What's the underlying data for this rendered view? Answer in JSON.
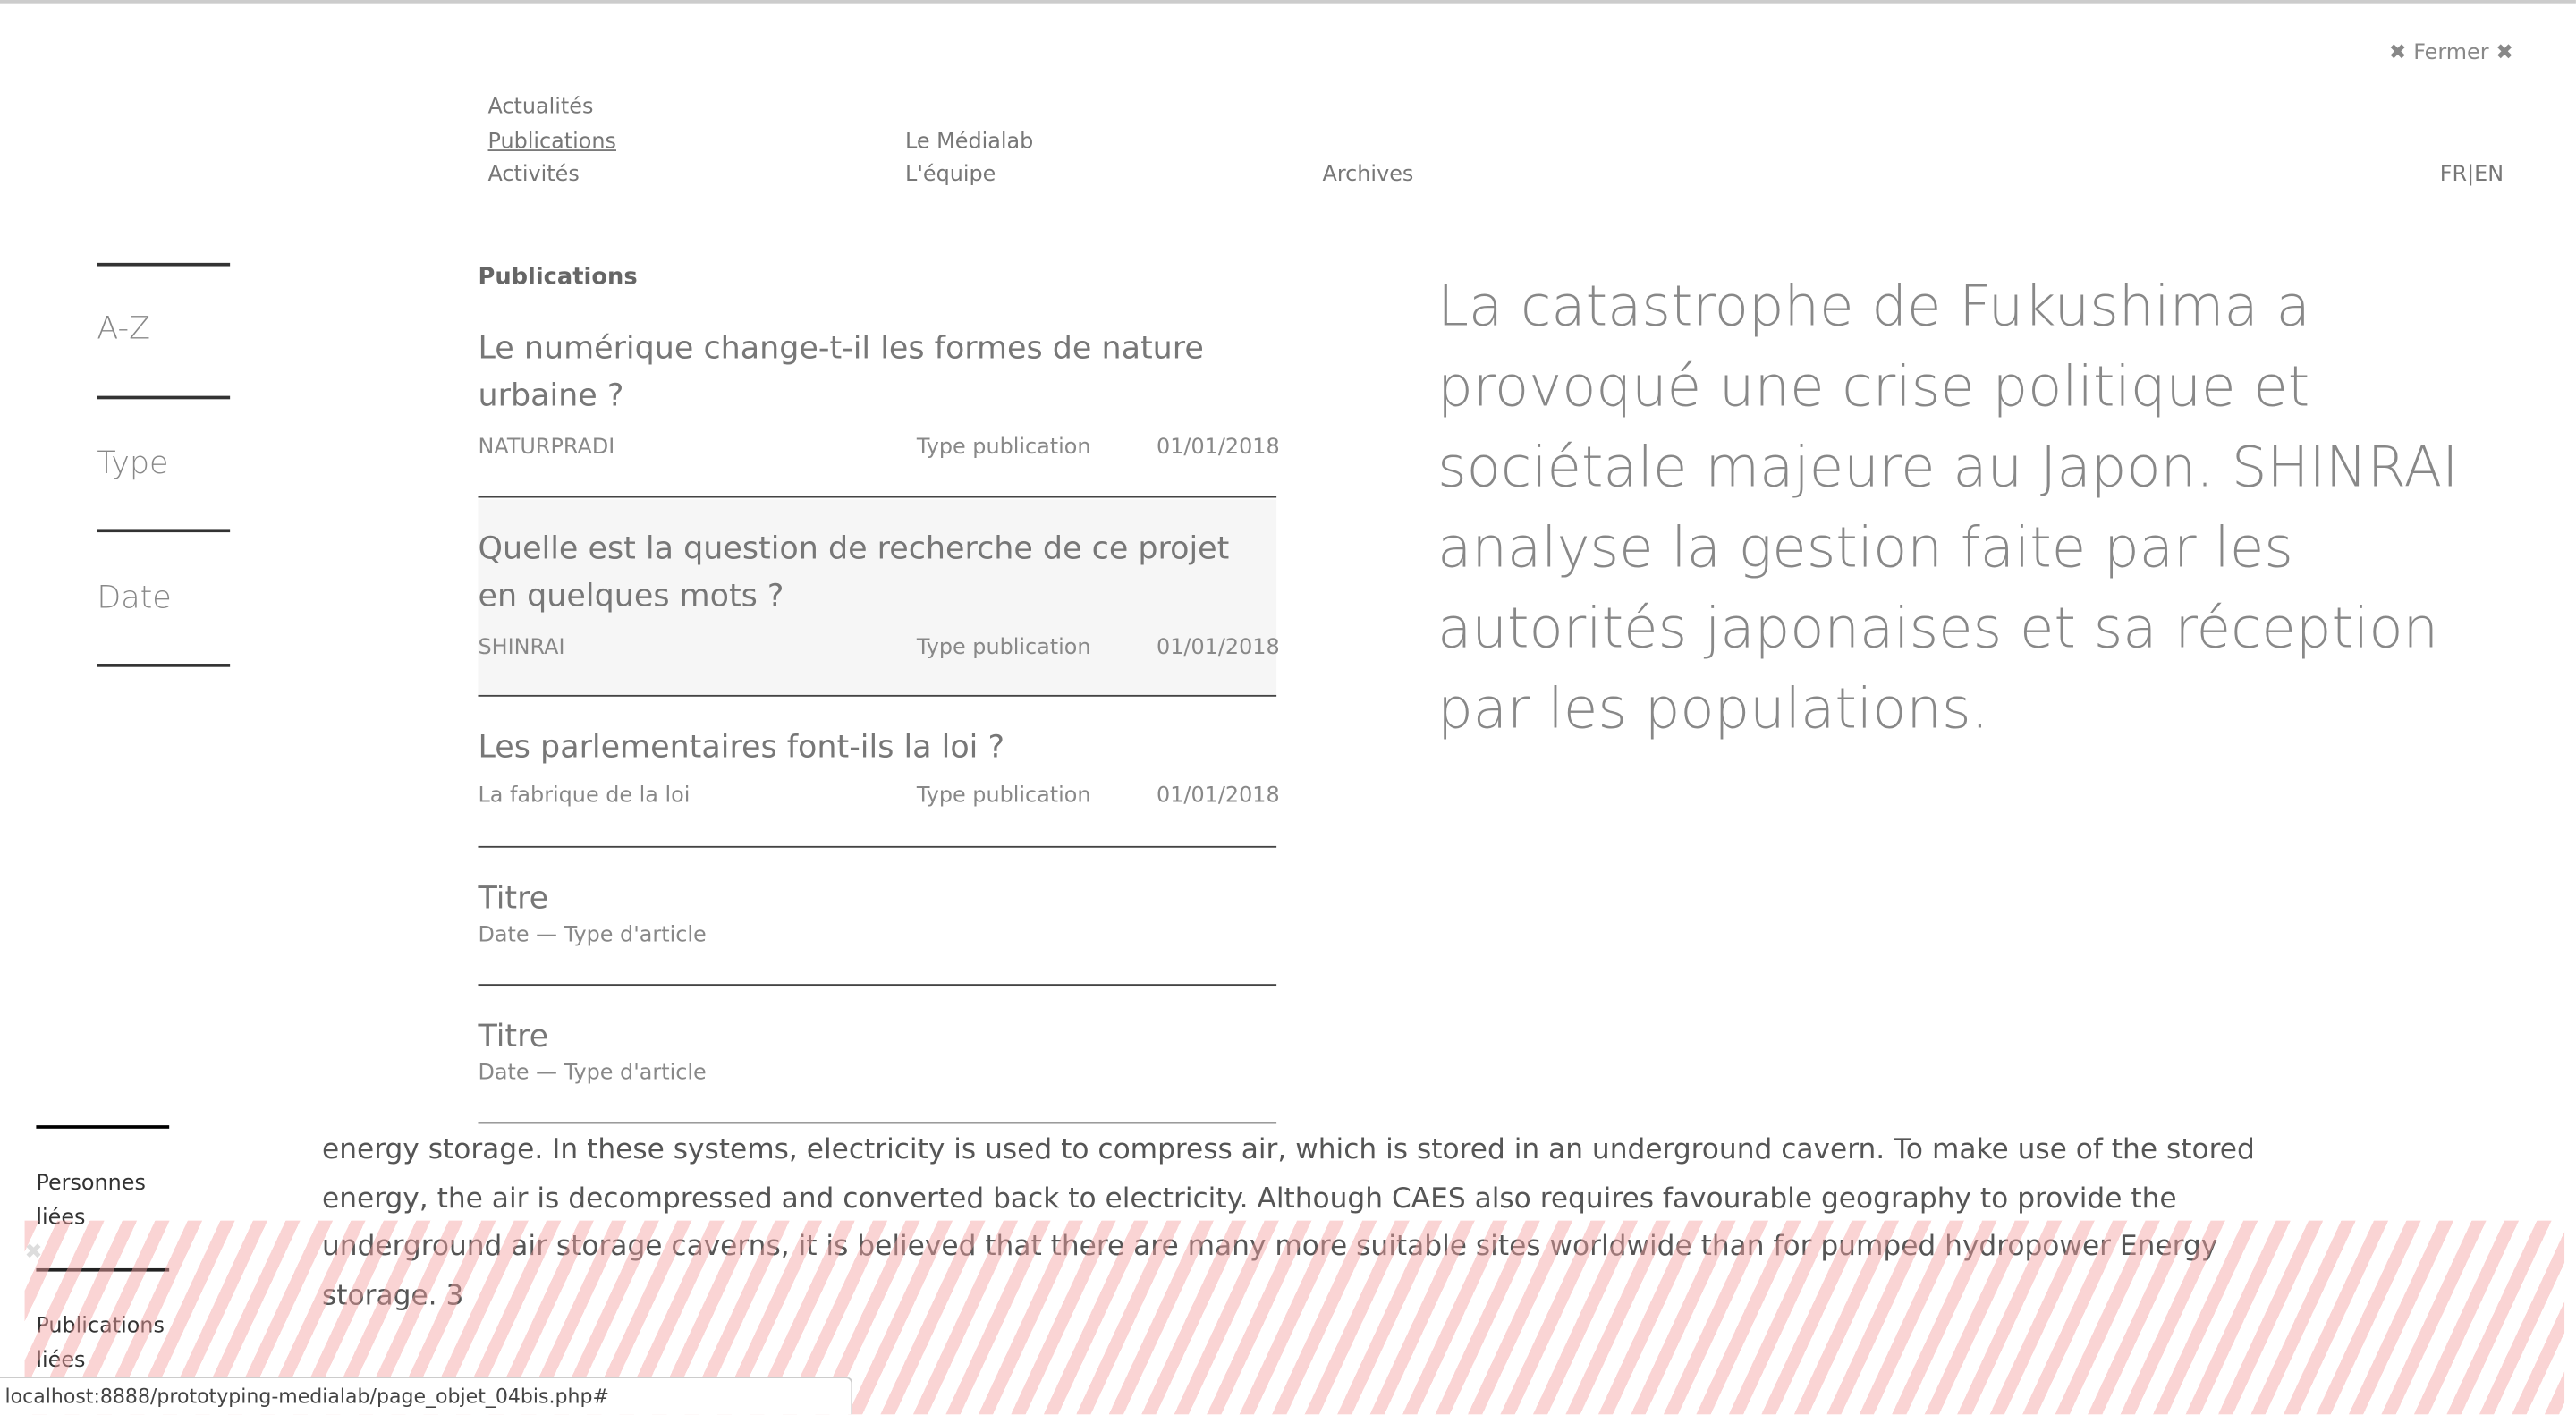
{
  "close": {
    "label": "Fermer",
    "icon": "✖"
  },
  "nav": {
    "actualites": "Actualités",
    "publications": "Publications",
    "activites": "Activités",
    "medialab": "Le Médialab",
    "equipe": "L'équipe",
    "archives": "Archives",
    "lang": "FR|EN"
  },
  "filters": [
    "A-Z",
    "Type",
    "Date"
  ],
  "list": {
    "heading": "Publications",
    "items": [
      {
        "title": "Le numérique change-t-il les formes de nature urbaine ?",
        "project": "NATURPRADI",
        "type": "Type publication",
        "date": "01/01/2018"
      },
      {
        "title": "Quelle est la question de recherche de ce projet en quelques mots ?",
        "project": "SHINRAI",
        "type": "Type publication",
        "date": "01/01/2018"
      },
      {
        "title": "Les parlementaires font-ils la loi ?",
        "project": "La fabrique de la loi",
        "type": "Type publication",
        "date": "01/01/2018"
      },
      {
        "title": "Titre",
        "meta": "Date — Type d'article"
      },
      {
        "title": "Titre",
        "meta": "Date — Type d'article"
      }
    ]
  },
  "summary": "La catastrophe de Fukushima a provoqué une crise politique et sociétale majeure au Japon. SHINRAI analyse la gestion faite par les autorités japonaises et sa réception par les populations.",
  "related": {
    "people": "Personnes liées",
    "publications": "Publications liées"
  },
  "body_text": "energy storage. In these systems, electricity is used to compress air, which is stored in an underground cavern. To make use of the stored energy, the air is decompressed and converted back to electricity. Although CAES also requires favourable geography to provide the underground air storage caverns, it is believed that there are many more suitable sites worldwide than for pumped hydropower Energy storage. 3",
  "status_url": "localhost:8888/prototyping-medialab/page_objet_04bis.php#"
}
